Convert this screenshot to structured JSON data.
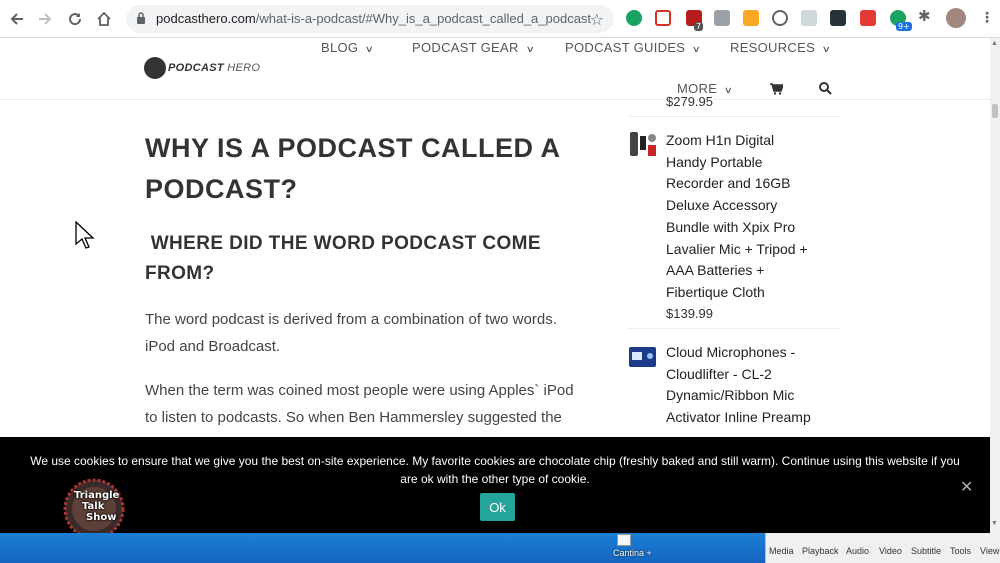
{
  "browser": {
    "url_domain": "podcasthero.com",
    "url_path": "/what-is-a-podcast/#Why_is_a_podcast_called_a_podcast",
    "extension_badges": [
      "7",
      "9+"
    ]
  },
  "site": {
    "logo_bold": "PODCAST",
    "logo_light": "HERO",
    "menu": [
      "BLOG",
      "PODCAST GEAR",
      "PODCAST GUIDES",
      "RESOURCES",
      "MORE"
    ]
  },
  "article": {
    "h1_line1": "WHY IS A PODCAST CALLED A",
    "h1_line2": "PODCAST?",
    "h2_line1": "WHERE DID THE WORD PODCAST COME",
    "h2_line2": "FROM?",
    "p1_line1": "The word podcast is derived from a combination of two words.",
    "p1_line2": "iPod and Broadcast.",
    "p2_line1": "When the term was coined most people were using Apples` iPod",
    "p2_line2": "to listen to podcasts. So when Ben Hammersley suggested the"
  },
  "sidebar": {
    "price_top": "$279.95",
    "products": [
      {
        "lines": [
          "Zoom H1n Digital",
          "Handy Portable",
          "Recorder and 16GB",
          "Deluxe Accessory",
          "Bundle with Xpix Pro",
          "Lavalier Mic + Tripod +",
          "AAA Batteries +",
          "Fibertique Cloth"
        ],
        "price": "$139.99"
      },
      {
        "lines": [
          "Cloud Microphones -",
          "Cloudlifter - CL-2",
          "Dynamic/Ribbon Mic",
          "Activator Inline Preamp"
        ],
        "price": ""
      }
    ]
  },
  "cookie": {
    "line1": "We use cookies to ensure that we give you the best on-site experience. My favorite cookies are chocolate chip (freshly baked and still warm). Continue using this website if you",
    "line2": "are ok with the other type of cookie.",
    "ok_label": "Ok",
    "close_label": "✕"
  },
  "overlay_logo": [
    "Triangle",
    "Talk",
    "Show"
  ],
  "desktop": {
    "icon_label": "Cantina +",
    "vlc_menu": [
      "Media",
      "Playback",
      "Audio",
      "Video",
      "Subtitle",
      "Tools",
      "View"
    ]
  },
  "colors": {
    "accent": "#26a69a",
    "banner": "#000000",
    "heading": "#333333"
  }
}
